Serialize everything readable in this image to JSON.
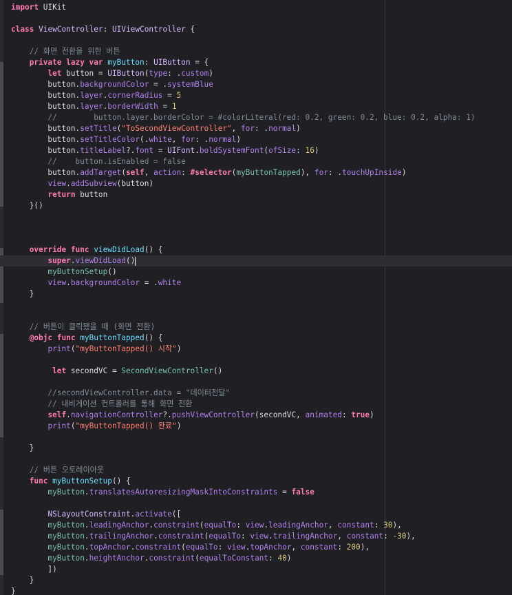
{
  "editor": {
    "language": "Swift",
    "theme_colors": {
      "background": "#1f1f24",
      "keyword": "#ff7ab2",
      "type": "#dabaff",
      "property": "#b281eb",
      "function": "#67b7a4",
      "string": "#ff8170",
      "number": "#d9c97c",
      "comment": "#7f8c98",
      "plain": "#dcdcdc"
    },
    "current_line_index": 23,
    "lines": [
      [
        [
          "kw",
          "import"
        ],
        [
          "pl",
          " UIKit"
        ]
      ],
      [],
      [
        [
          "kw",
          "class"
        ],
        [
          "pl",
          " "
        ],
        [
          "tp",
          "ViewController"
        ],
        [
          "pl",
          ": "
        ],
        [
          "cls",
          "UIViewController"
        ],
        [
          "pl",
          " {"
        ]
      ],
      [],
      [
        [
          "cmt",
          "    // 화면 전환을 위한 버튼"
        ]
      ],
      [
        [
          "pl",
          "    "
        ],
        [
          "kw",
          "private lazy var"
        ],
        [
          "pl",
          " "
        ],
        [
          "ty",
          "myButton"
        ],
        [
          "pl",
          ": "
        ],
        [
          "cls",
          "UIButton"
        ],
        [
          "pl",
          " = {"
        ]
      ],
      [
        [
          "pl",
          "        "
        ],
        [
          "kw",
          "let"
        ],
        [
          "pl",
          " button = "
        ],
        [
          "cls",
          "UIButton"
        ],
        [
          "pl",
          "("
        ],
        [
          "prop",
          "type"
        ],
        [
          "pl",
          ": ."
        ],
        [
          "prop",
          "custom"
        ],
        [
          "pl",
          ")"
        ]
      ],
      [
        [
          "pl",
          "        button."
        ],
        [
          "prop",
          "backgroundColor"
        ],
        [
          "pl",
          " = ."
        ],
        [
          "prop",
          "systemBlue"
        ]
      ],
      [
        [
          "pl",
          "        button."
        ],
        [
          "prop",
          "layer"
        ],
        [
          "pl",
          "."
        ],
        [
          "prop",
          "cornerRadius"
        ],
        [
          "pl",
          " = "
        ],
        [
          "num",
          "5"
        ]
      ],
      [
        [
          "pl",
          "        button."
        ],
        [
          "prop",
          "layer"
        ],
        [
          "pl",
          "."
        ],
        [
          "prop",
          "borderWidth"
        ],
        [
          "pl",
          " = "
        ],
        [
          "num",
          "1"
        ]
      ],
      [
        [
          "cmt",
          "        //        button.layer.borderColor = #colorLiteral(red: 0.2, green: 0.2, blue: 0.2, alpha: 1)"
        ]
      ],
      [
        [
          "pl",
          "        button."
        ],
        [
          "prop",
          "setTitle"
        ],
        [
          "pl",
          "("
        ],
        [
          "str",
          "\"ToSecondViewController\""
        ],
        [
          "pl",
          ", "
        ],
        [
          "prop",
          "for"
        ],
        [
          "pl",
          ": ."
        ],
        [
          "prop",
          "normal"
        ],
        [
          "pl",
          ")"
        ]
      ],
      [
        [
          "pl",
          "        button."
        ],
        [
          "prop",
          "setTitleColor"
        ],
        [
          "pl",
          "(."
        ],
        [
          "prop",
          "white"
        ],
        [
          "pl",
          ", "
        ],
        [
          "prop",
          "for"
        ],
        [
          "pl",
          ": ."
        ],
        [
          "prop",
          "normal"
        ],
        [
          "pl",
          ")"
        ]
      ],
      [
        [
          "pl",
          "        button."
        ],
        [
          "prop",
          "titleLabel"
        ],
        [
          "pl",
          "?."
        ],
        [
          "prop",
          "font"
        ],
        [
          "pl",
          " = "
        ],
        [
          "cls",
          "UIFont"
        ],
        [
          "pl",
          "."
        ],
        [
          "prop",
          "boldSystemFont"
        ],
        [
          "pl",
          "("
        ],
        [
          "prop",
          "ofSize"
        ],
        [
          "pl",
          ": "
        ],
        [
          "num",
          "16"
        ],
        [
          "pl",
          ")"
        ]
      ],
      [
        [
          "cmt",
          "        //    button.isEnabled = false"
        ]
      ],
      [
        [
          "pl",
          "        button."
        ],
        [
          "prop",
          "addTarget"
        ],
        [
          "pl",
          "("
        ],
        [
          "kw",
          "self"
        ],
        [
          "pl",
          ", "
        ],
        [
          "prop",
          "action"
        ],
        [
          "pl",
          ": "
        ],
        [
          "kw",
          "#selector"
        ],
        [
          "pl",
          "("
        ],
        [
          "fnc",
          "myButtonTapped"
        ],
        [
          "pl",
          "), "
        ],
        [
          "prop",
          "for"
        ],
        [
          "pl",
          ": ."
        ],
        [
          "prop",
          "touchUpInside"
        ],
        [
          "pl",
          ")"
        ]
      ],
      [
        [
          "pl",
          "        "
        ],
        [
          "prop",
          "view"
        ],
        [
          "pl",
          "."
        ],
        [
          "prop",
          "addSubview"
        ],
        [
          "pl",
          "(button)"
        ]
      ],
      [
        [
          "pl",
          "        "
        ],
        [
          "kw",
          "return"
        ],
        [
          "pl",
          " button"
        ]
      ],
      [
        [
          "pl",
          "    }()"
        ]
      ],
      [],
      [],
      [],
      [
        [
          "pl",
          "    "
        ],
        [
          "kw",
          "override func"
        ],
        [
          "pl",
          " "
        ],
        [
          "ty",
          "viewDidLoad"
        ],
        [
          "pl",
          "() {"
        ]
      ],
      [
        [
          "pl",
          "        "
        ],
        [
          "kw",
          "super"
        ],
        [
          "pl",
          "."
        ],
        [
          "prop",
          "viewDidLoad"
        ],
        [
          "pl",
          "()"
        ],
        [
          "cursor",
          ""
        ]
      ],
      [
        [
          "pl",
          "        "
        ],
        [
          "fnc",
          "myButtonSetup"
        ],
        [
          "pl",
          "()"
        ]
      ],
      [
        [
          "pl",
          "        "
        ],
        [
          "prop",
          "view"
        ],
        [
          "pl",
          "."
        ],
        [
          "prop",
          "backgroundColor"
        ],
        [
          "pl",
          " = ."
        ],
        [
          "prop",
          "white"
        ]
      ],
      [
        [
          "pl",
          "    }"
        ]
      ],
      [],
      [],
      [
        [
          "cmt",
          "    // 버튼이 클릭됐을 때 (화면 전환)"
        ]
      ],
      [
        [
          "pl",
          "    "
        ],
        [
          "kw",
          "@objc func"
        ],
        [
          "pl",
          " "
        ],
        [
          "ty",
          "myButtonTapped"
        ],
        [
          "pl",
          "() {"
        ]
      ],
      [
        [
          "pl",
          "        "
        ],
        [
          "prop",
          "print"
        ],
        [
          "pl",
          "("
        ],
        [
          "str",
          "\"myButtonTapped() 시작\""
        ],
        [
          "pl",
          ")"
        ]
      ],
      [],
      [
        [
          "pl",
          "         "
        ],
        [
          "kw",
          "let"
        ],
        [
          "pl",
          " secondVC = "
        ],
        [
          "fnc",
          "SecondViewController"
        ],
        [
          "pl",
          "()"
        ]
      ],
      [],
      [
        [
          "cmt",
          "        //secondViewController.data = \"데이터전달\""
        ]
      ],
      [
        [
          "cmt",
          "        // 내비게이션 컨트롤러를 통해 화면 전환"
        ]
      ],
      [
        [
          "pl",
          "        "
        ],
        [
          "kw",
          "self"
        ],
        [
          "pl",
          "."
        ],
        [
          "prop",
          "navigationController"
        ],
        [
          "pl",
          "?."
        ],
        [
          "prop",
          "pushViewController"
        ],
        [
          "pl",
          "(secondVC, "
        ],
        [
          "prop",
          "animated"
        ],
        [
          "pl",
          ": "
        ],
        [
          "kw",
          "true"
        ],
        [
          "pl",
          ")"
        ]
      ],
      [
        [
          "pl",
          "        "
        ],
        [
          "prop",
          "print"
        ],
        [
          "pl",
          "("
        ],
        [
          "str",
          "\"myButtonTapped() 완료\""
        ],
        [
          "pl",
          ")"
        ]
      ],
      [],
      [
        [
          "pl",
          "    }"
        ]
      ],
      [],
      [
        [
          "cmt",
          "    // 버튼 오토레이아웃"
        ]
      ],
      [
        [
          "pl",
          "    "
        ],
        [
          "kw",
          "func"
        ],
        [
          "pl",
          " "
        ],
        [
          "ty",
          "myButtonSetup"
        ],
        [
          "pl",
          "() {"
        ]
      ],
      [
        [
          "pl",
          "        "
        ],
        [
          "fnc",
          "myButton"
        ],
        [
          "pl",
          "."
        ],
        [
          "prop",
          "translatesAutoresizingMaskIntoConstraints"
        ],
        [
          "pl",
          " = "
        ],
        [
          "kw",
          "false"
        ]
      ],
      [],
      [
        [
          "pl",
          "        "
        ],
        [
          "cls",
          "NSLayoutConstraint"
        ],
        [
          "pl",
          "."
        ],
        [
          "prop",
          "activate"
        ],
        [
          "pl",
          "(["
        ]
      ],
      [
        [
          "pl",
          "        "
        ],
        [
          "fnc",
          "myButton"
        ],
        [
          "pl",
          "."
        ],
        [
          "prop",
          "leadingAnchor"
        ],
        [
          "pl",
          "."
        ],
        [
          "prop",
          "constraint"
        ],
        [
          "pl",
          "("
        ],
        [
          "prop",
          "equalTo"
        ],
        [
          "pl",
          ": "
        ],
        [
          "prop",
          "view"
        ],
        [
          "pl",
          "."
        ],
        [
          "prop",
          "leadingAnchor"
        ],
        [
          "pl",
          ", "
        ],
        [
          "prop",
          "constant"
        ],
        [
          "pl",
          ": "
        ],
        [
          "num",
          "30"
        ],
        [
          "pl",
          "),"
        ]
      ],
      [
        [
          "pl",
          "        "
        ],
        [
          "fnc",
          "myButton"
        ],
        [
          "pl",
          "."
        ],
        [
          "prop",
          "trailingAnchor"
        ],
        [
          "pl",
          "."
        ],
        [
          "prop",
          "constraint"
        ],
        [
          "pl",
          "("
        ],
        [
          "prop",
          "equalTo"
        ],
        [
          "pl",
          ": "
        ],
        [
          "prop",
          "view"
        ],
        [
          "pl",
          "."
        ],
        [
          "prop",
          "trailingAnchor"
        ],
        [
          "pl",
          ", "
        ],
        [
          "prop",
          "constant"
        ],
        [
          "pl",
          ": "
        ],
        [
          "num",
          "-30"
        ],
        [
          "pl",
          "),"
        ]
      ],
      [
        [
          "pl",
          "        "
        ],
        [
          "fnc",
          "myButton"
        ],
        [
          "pl",
          "."
        ],
        [
          "prop",
          "topAnchor"
        ],
        [
          "pl",
          "."
        ],
        [
          "prop",
          "constraint"
        ],
        [
          "pl",
          "("
        ],
        [
          "prop",
          "equalTo"
        ],
        [
          "pl",
          ": "
        ],
        [
          "prop",
          "view"
        ],
        [
          "pl",
          "."
        ],
        [
          "prop",
          "topAnchor"
        ],
        [
          "pl",
          ", "
        ],
        [
          "prop",
          "constant"
        ],
        [
          "pl",
          ": "
        ],
        [
          "num",
          "200"
        ],
        [
          "pl",
          "),"
        ]
      ],
      [
        [
          "pl",
          "        "
        ],
        [
          "fnc",
          "myButton"
        ],
        [
          "pl",
          "."
        ],
        [
          "prop",
          "heightAnchor"
        ],
        [
          "pl",
          "."
        ],
        [
          "prop",
          "constraint"
        ],
        [
          "pl",
          "("
        ],
        [
          "prop",
          "equalToConstant"
        ],
        [
          "pl",
          ": "
        ],
        [
          "num",
          "40"
        ],
        [
          "pl",
          ")"
        ]
      ],
      [
        [
          "pl",
          "        ])"
        ]
      ],
      [
        [
          "pl",
          "    }"
        ]
      ],
      [
        [
          "pl",
          "}"
        ]
      ]
    ]
  }
}
